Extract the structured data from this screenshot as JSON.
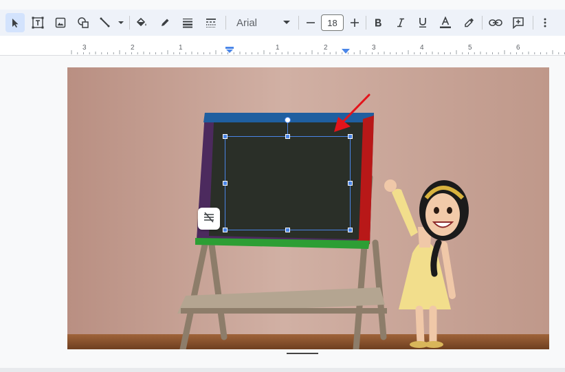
{
  "toolbar": {
    "tools": [
      {
        "name": "select",
        "icon": "cursor-arrow-icon",
        "active": true
      },
      {
        "name": "text-box",
        "icon": "text-box-icon"
      },
      {
        "name": "image",
        "icon": "image-icon"
      },
      {
        "name": "shape",
        "icon": "shape-icon"
      },
      {
        "name": "line",
        "icon": "line-icon"
      },
      {
        "name": "fill-color",
        "icon": "paint-bucket-icon"
      },
      {
        "name": "border-color",
        "icon": "pencil-icon"
      },
      {
        "name": "border-weight",
        "icon": "line-weight-icon"
      },
      {
        "name": "border-dash",
        "icon": "line-dash-icon"
      },
      {
        "name": "decrease-size",
        "icon": "minus-icon"
      },
      {
        "name": "increase-size",
        "icon": "plus-icon"
      },
      {
        "name": "bold",
        "icon": "bold-icon"
      },
      {
        "name": "italic",
        "icon": "italic-icon"
      },
      {
        "name": "underline",
        "icon": "underline-icon"
      },
      {
        "name": "text-color",
        "icon": "text-color-icon"
      },
      {
        "name": "highlight",
        "icon": "highlighter-icon"
      },
      {
        "name": "link",
        "icon": "link-icon"
      },
      {
        "name": "comment",
        "icon": "add-comment-icon"
      },
      {
        "name": "more",
        "icon": "more-vert-icon"
      }
    ],
    "font_name": "Arial",
    "font_size": "18",
    "accent_color": "#1a73e8",
    "active_bg": "#d3e3fd"
  },
  "ruler": {
    "labels_left": [
      "3",
      "2",
      "1"
    ],
    "labels_right": [
      "1",
      "2",
      "3",
      "4",
      "5",
      "6"
    ]
  },
  "slide": {
    "background_color": "#c9a69a",
    "floor_color": "#8a5530",
    "chalkboard_color": "#2a2f28",
    "selection_color": "#4a86e8",
    "arrow_color": "#e3141b"
  }
}
